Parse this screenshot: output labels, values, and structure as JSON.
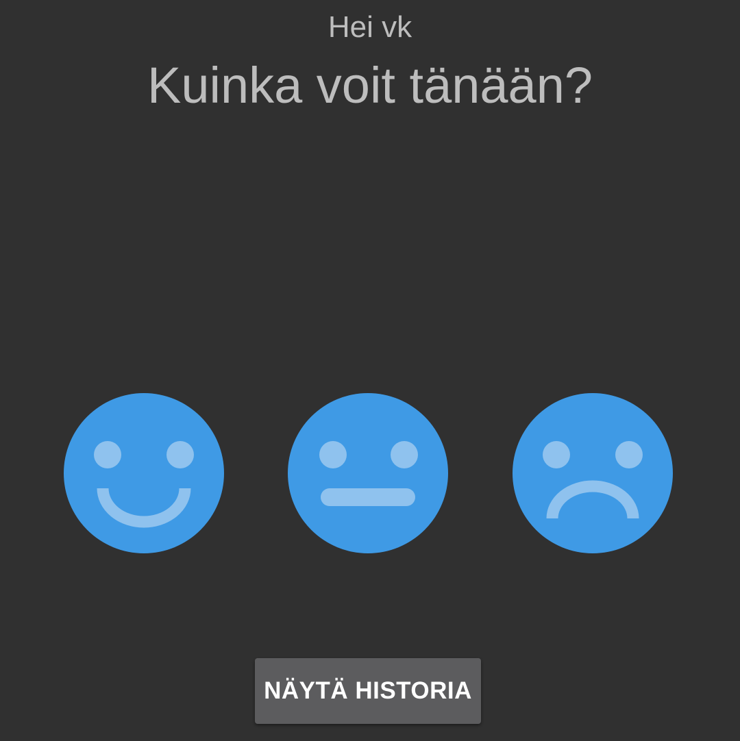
{
  "header": {
    "greeting": "Hei vk",
    "question": "Kuinka voit tänään?"
  },
  "moods": [
    {
      "name": "happy",
      "icon": "happy-face-icon"
    },
    {
      "name": "neutral",
      "icon": "neutral-face-icon"
    },
    {
      "name": "sad",
      "icon": "sad-face-icon"
    }
  ],
  "actions": {
    "history_label": "NÄYTÄ HISTORIA"
  },
  "colors": {
    "background": "#303030",
    "face": "#3f9ae5",
    "face_features": "#8fc2ee",
    "text": "#bdbdbd",
    "button": "#5c5c5e"
  }
}
